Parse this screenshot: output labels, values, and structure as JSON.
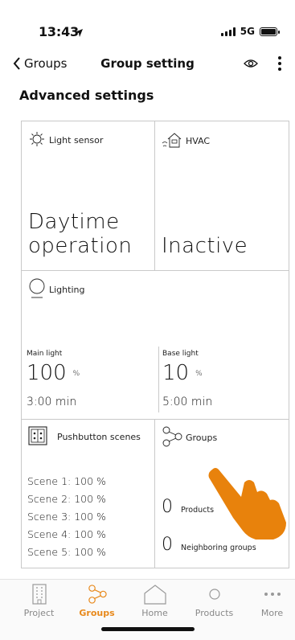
{
  "status": {
    "time": "13:43",
    "network": "5G"
  },
  "nav": {
    "back_label": "Groups",
    "title": "Group setting"
  },
  "section_title": "Advanced settings",
  "tiles": {
    "light_sensor": {
      "label": "Light sensor",
      "value": "Daytime operation"
    },
    "hvac": {
      "label": "HVAC",
      "value": "Inactive"
    },
    "lighting": {
      "label": "Lighting",
      "main": {
        "label": "Main light",
        "value": "100",
        "unit": "%",
        "time": "3:00 min"
      },
      "base": {
        "label": "Base light",
        "value": "10",
        "unit": "%",
        "time": "5:00 min"
      }
    },
    "pushbutton": {
      "label": "Pushbutton scenes",
      "scenes": [
        "Scene 1: 100 %",
        "Scene 2: 100 %",
        "Scene 3: 100 %",
        "Scene 4: 100 %",
        "Scene 5: 100 %"
      ]
    },
    "groups": {
      "label": "Groups",
      "products_count": "0",
      "products_label": "Products",
      "neighbors_count": "0",
      "neighbors_label": "Neighboring groups"
    }
  },
  "tabs": [
    {
      "label": "Project",
      "icon": "building-icon"
    },
    {
      "label": "Groups",
      "icon": "groups-icon"
    },
    {
      "label": "Home",
      "icon": "home-icon"
    },
    {
      "label": "Products",
      "icon": "product-icon"
    },
    {
      "label": "More",
      "icon": "more-icon"
    }
  ],
  "colors": {
    "accent": "#e8891b",
    "hand": "#e8820c"
  }
}
